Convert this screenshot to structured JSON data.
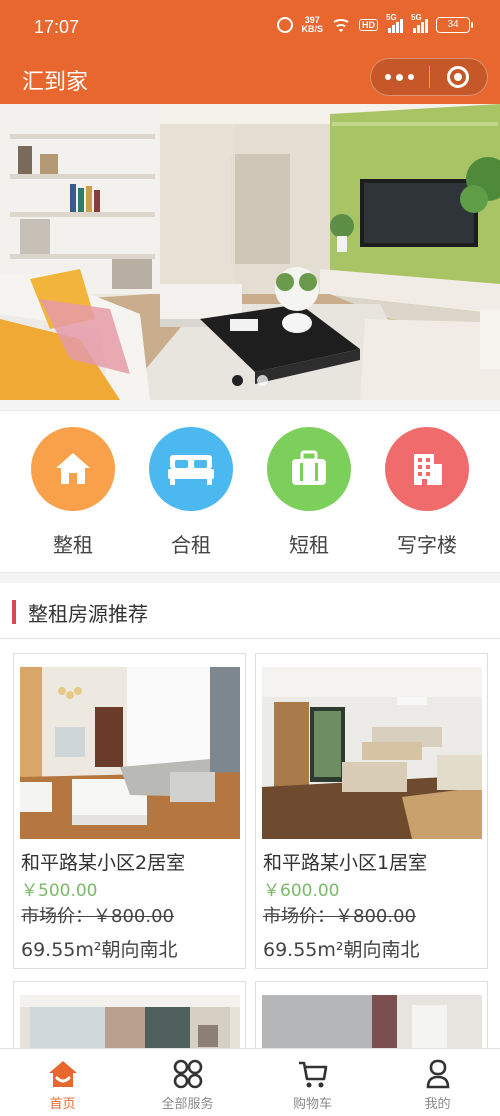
{
  "status_bar": {
    "time": "17:07",
    "net_speed_value": "397",
    "net_speed_unit": "KB/S",
    "hd_label": "HD",
    "sim1_label": "5G",
    "sim2_label": "5G",
    "battery": "34"
  },
  "nav": {
    "title": "汇到家"
  },
  "banner": {
    "slide_count": 2,
    "active_index": 0
  },
  "categories": [
    {
      "label": "整租",
      "icon": "house-icon",
      "color": "#f8a14a"
    },
    {
      "label": "合租",
      "icon": "bed-icon",
      "color": "#4bb8f0"
    },
    {
      "label": "短租",
      "icon": "suitcase-icon",
      "color": "#7dcf5c"
    },
    {
      "label": "写字楼",
      "icon": "office-building-icon",
      "color": "#f06b6b"
    }
  ],
  "section": {
    "title": "整租房源推荐"
  },
  "listings": [
    {
      "name": "和平路某小区2居室",
      "price": "￥500.00",
      "market_price": "市场价：￥800.00",
      "area": "69.55m²朝向南北"
    },
    {
      "name": "和平路某小区1居室",
      "price": "￥600.00",
      "market_price": "市场价：￥800.00",
      "area": "69.55m²朝向南北"
    }
  ],
  "tabbar": [
    {
      "label": "首页",
      "icon": "home-icon",
      "active": true
    },
    {
      "label": "全部服务",
      "icon": "services-grid-icon",
      "active": false
    },
    {
      "label": "购物车",
      "icon": "cart-icon",
      "active": false
    },
    {
      "label": "我的",
      "icon": "profile-icon",
      "active": false
    }
  ],
  "colors": {
    "brand": "#e8672f",
    "price_green": "#7bb96a",
    "section_accent": "#d9484c"
  }
}
